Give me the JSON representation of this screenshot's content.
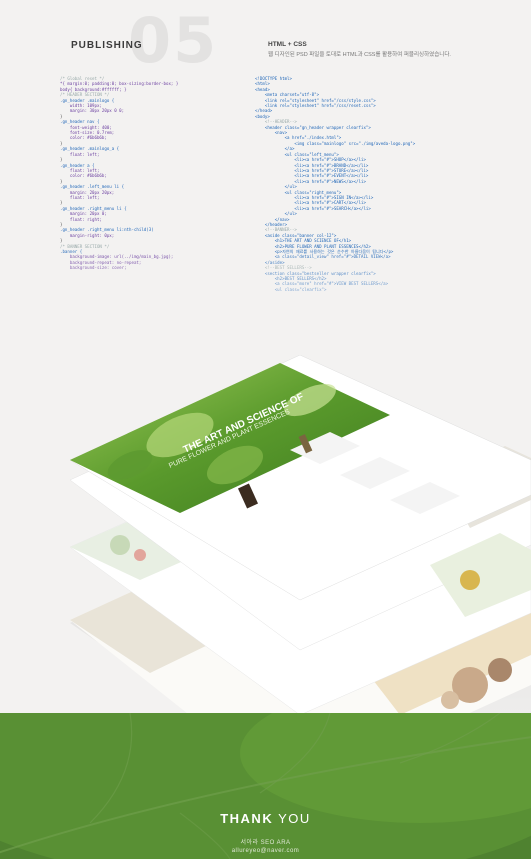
{
  "section": {
    "label": "PUBLISHING",
    "number": "05",
    "desc_title": "HTML + CSS",
    "desc_text": "웹 디자인된 PSD 파일을 토대로 HTML과 CSS를 활용하여 퍼블리싱하였습니다."
  },
  "code": {
    "left_lines": [
      "/* Global reset */",
      "*{ margin:0; padding:0; box-sizing:border-box; }",
      "body{ background:#ffffff; }",
      "",
      "/* HEADER SECTION */",
      ".gn_header .mainlogo {",
      "    width: 109px;",
      "    margin: 30px 20px 0 0;",
      "}",
      "",
      ".gn_header nav {",
      "    font-weight: 400;",
      "    font-size: 0.7rem;",
      "    color: #6b6b6b;",
      "}",
      "",
      ".gn_header .mainlogo_a {",
      "    float: left;",
      "}",
      "",
      ".gn_header a {",
      "    float: left;",
      "    color: #6b6b6b;",
      "}",
      "",
      ".gn_header .left_menu li {",
      "    margin: 20px 20px;",
      "    float: left;",
      "}",
      "",
      ".gn_header .right_menu li {",
      "    margin: 20px 0;",
      "    float: right;",
      "}",
      "",
      ".gn_header .right_menu li:nth-child(3)",
      "    margin-right: 0px;",
      "}",
      "",
      "/* BANNER SECTION */",
      ".banner {",
      "    background-image: url(../img/main_bg.jpg);",
      "    background-repeat: no-repeat;",
      "    background-size: cover;"
    ],
    "right_lines": [
      "<!DOCTYPE html>",
      "<html>",
      "<head>",
      "    <meta charset=\"utf-8\">",
      "    <link rel=\"stylesheet\" href=\"/css/style.css\">",
      "    <link rel=\"stylesheet\" href=\"/css/reset.css\">",
      "</head>",
      "<body>",
      "",
      "    <!--HEADER-->",
      "    <header class=\"gn_header wrapper clearfix\">",
      "        <nav>",
      "            <a href=\"./index.html\">",
      "                <img class=\"mainlogo\" src=\"./img/aveda-logo.png\">",
      "            </a>",
      "            <ul class=\"left_menu\">",
      "                <li><a href=\"#\">SHOP</a></li>",
      "                <li><a href=\"#\">BRAND</a></li>",
      "                <li><a href=\"#\">STORE</a></li>",
      "                <li><a href=\"#\">EVENT</a></li>",
      "                <li><a href=\"#\">NEWS</a></li>",
      "            </ul>",
      "",
      "            <ul class=\"right_menu\">",
      "                <li><a href=\"#\">SIGN IN</a></li>",
      "                <li><a href=\"#\">CART</a></li>",
      "                <li><a href=\"#\">SEARCH</a></li>",
      "            </ul>",
      "        </nav>",
      "    </header>",
      "",
      "    <!--BANNER-->",
      "",
      "    <aside class=\"banner col-12\">",
      "        <h1>THE ART AND SCIENCE OF</h1>",
      "        <h2>PURE FLOWER AND PLANT ESSENCES</h2>",
      "        <p>자연의 재료를 사용하는 것은 순수한 아름다움이 됩니다</p>",
      "        <a class=\"detail_view\" href=\"#\">DETAIL VIEW</a>",
      "    </aside>",
      "",
      "    <!--BEST SELLERS-->",
      "",
      "    <section class=\"bestseller wrapper clearfix\">",
      "        <h2>BEST SELLERS</h2>",
      "        <a class=\"more\" href=\"#\">VIEW BEST SELLERS</a>",
      "",
      "        <ul class=\"clearfix\">"
    ]
  },
  "mockup": {
    "banner_line1": "THE ART AND SCIENCE OF",
    "banner_line2": "PURE FLOWER AND PLANT ESSENCES"
  },
  "footer": {
    "thanks_bold": "THANK",
    "thanks_light": " YOU",
    "author": "서아라 SEO ARA",
    "email": "allureyeo@naver.com"
  },
  "colors": {
    "background": "#f3f2f1",
    "footer_green": "#4f8230",
    "leaf_green": "#6aa43a",
    "number_gray": "#e3e2e1"
  }
}
